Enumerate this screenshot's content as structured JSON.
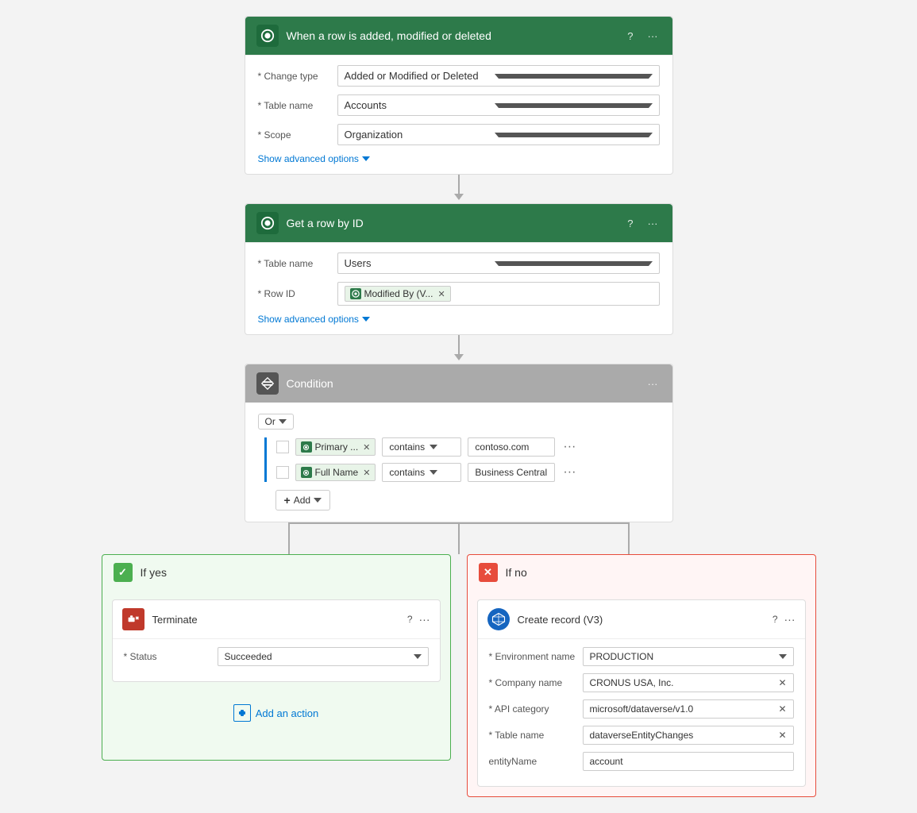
{
  "trigger": {
    "title": "When a row is added, modified or deleted",
    "change_type_label": "* Change type",
    "change_type_value": "Added or Modified or Deleted",
    "table_name_label": "* Table name",
    "table_name_value": "Accounts",
    "scope_label": "* Scope",
    "scope_value": "Organization",
    "show_advanced": "Show advanced options"
  },
  "get_row": {
    "title": "Get a row by ID",
    "table_name_label": "* Table name",
    "table_name_value": "Users",
    "row_id_label": "* Row ID",
    "row_id_token": "Modified By (V...",
    "show_advanced": "Show advanced options"
  },
  "condition": {
    "title": "Condition",
    "or_label": "Or",
    "rows": [
      {
        "token_label": "Primary ...",
        "operator": "contains",
        "value": "contoso.com"
      },
      {
        "token_label": "Full Name",
        "operator": "contains",
        "value": "Business Central"
      }
    ],
    "add_label": "Add"
  },
  "if_yes": {
    "label": "If yes",
    "terminate": {
      "title": "Terminate",
      "status_label": "* Status",
      "status_value": "Succeeded"
    },
    "add_action_label": "Add an action"
  },
  "if_no": {
    "label": "If no",
    "create_record": {
      "title": "Create record (V3)",
      "env_label": "* Environment name",
      "env_value": "PRODUCTION",
      "company_label": "* Company name",
      "company_value": "CRONUS USA, Inc.",
      "api_category_label": "* API category",
      "api_category_value": "microsoft/dataverse/v1.0",
      "table_name_label": "* Table name",
      "table_name_value": "dataverseEntityChanges",
      "entity_name_label": "entityName",
      "entity_name_value": "account"
    }
  }
}
